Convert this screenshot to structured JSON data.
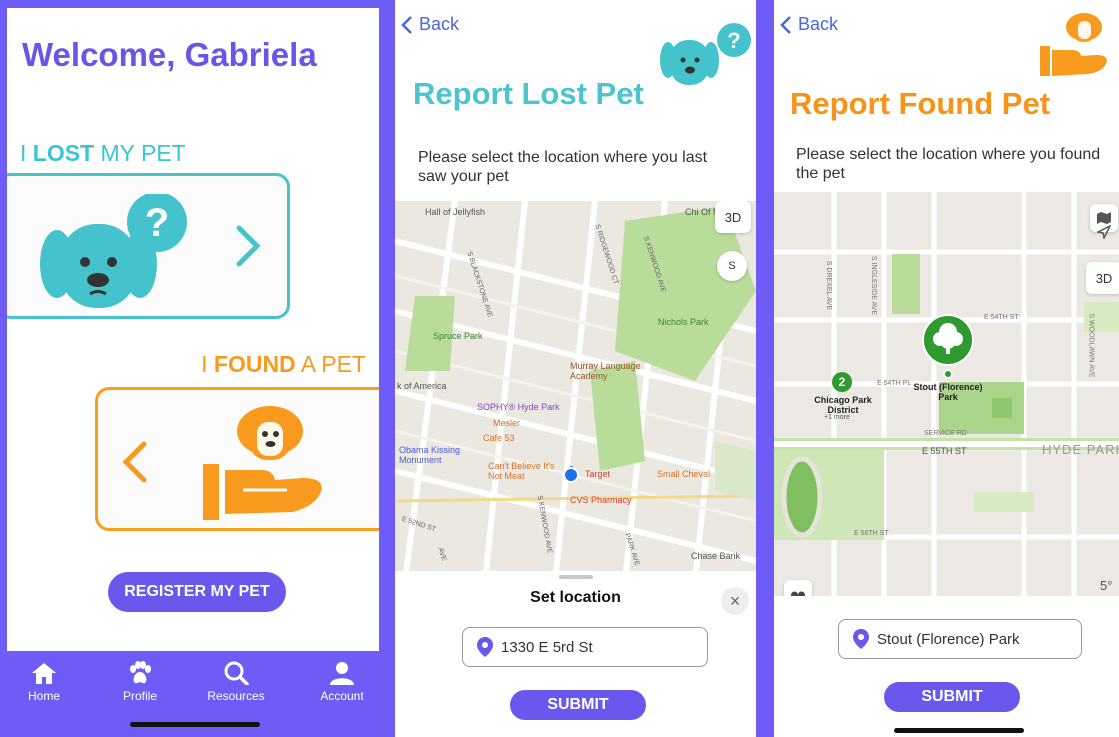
{
  "screen1": {
    "welcome": "Welcome, Gabriela",
    "lost": {
      "pre": "I ",
      "bold": "LOST",
      "post": " MY PET"
    },
    "found": {
      "pre": "I ",
      "bold": "FOUND",
      "post": " A PET"
    },
    "register_label": "REGISTER MY PET",
    "tabs": [
      {
        "label": "Home",
        "icon": "home-icon"
      },
      {
        "label": "Profile",
        "icon": "paw-icon"
      },
      {
        "label": "Resources",
        "icon": "search-icon"
      },
      {
        "label": "Account",
        "icon": "person-icon"
      }
    ]
  },
  "screen2": {
    "back": "Back",
    "title": "Report Lost Pet",
    "instruction": "Please select the location where you last saw your pet",
    "map": {
      "btn_3d": "3D",
      "compass": "S",
      "labels": {
        "hall": "Hall of Jellyfish",
        "chi": "Chi Of M",
        "spruce": "Spruce Park",
        "nichols": "Nichols Park",
        "murray": "Murray Language Academy",
        "america": "k of America",
        "sophy": "SOPHY® Hyde Park",
        "mesler": "Mesler",
        "cafe": "Cafe 53",
        "obama": "Obama Kissing Monument",
        "cantbelieve": "Can't Believe It's Not Meat",
        "target": "Target",
        "smallcheval": "Small Cheval",
        "cvs": "CVS Pharmacy",
        "chase": "Chase Bank",
        "blackstone": "S BLACKSTONE AVE",
        "ridgewood": "S RIDGEWOOD CT",
        "kenwood": "S KENWOOD AVE",
        "kenwood2": "S KENWOOD AVE",
        "park": "PARK AVE",
        "e52nd": "E 52ND ST",
        "ave": "AVE"
      }
    },
    "sheet_title": "Set location",
    "close": "×",
    "address": "1330 E 5rd St",
    "submit": "SUBMIT"
  },
  "screen3": {
    "back": "Back",
    "title": "Report Found Pet",
    "instruction": "Please select the location where you found the pet",
    "map": {
      "btn_3d": "3D",
      "labels": {
        "drexel": "S DREXEL AVE",
        "ingleside": "S INGLESIDE AVE",
        "woodlawn": "S WOODLAWN AVE",
        "e54th": "E 54TH ST",
        "e54thpl": "E 54TH PL",
        "chicago": "Chicago Park District",
        "more": "+1 more",
        "stout": "Stout (Florence) Park",
        "servicerd": "SERVICE RD",
        "e55th": "E 55TH ST",
        "hydepark": "HYDE PARK",
        "e56th": "E 56TH ST",
        "badge": "2",
        "temp": "5°"
      }
    },
    "address": "Stout (Florence) Park",
    "submit": "SUBMIT"
  },
  "colors": {
    "purple": "#6f5bf5",
    "teal": "#46c3cd",
    "orange": "#f79a1e"
  }
}
